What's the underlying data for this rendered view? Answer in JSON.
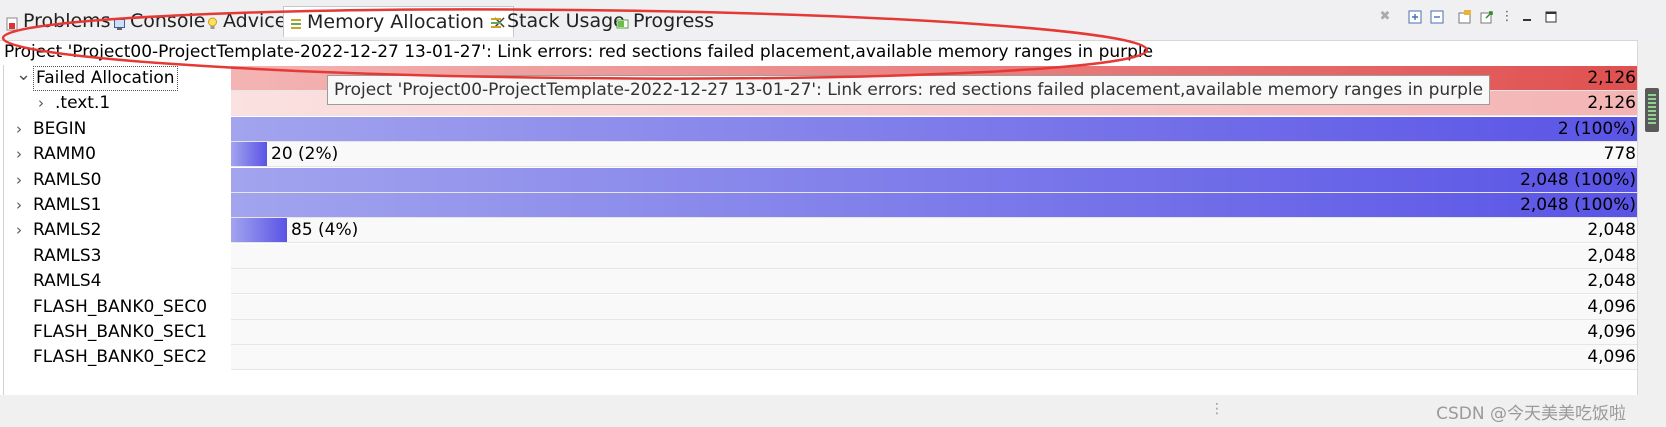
{
  "tabs": [
    {
      "label": "Problems",
      "icon": "problems-icon",
      "active": false
    },
    {
      "label": "Console",
      "icon": "console-icon",
      "active": false
    },
    {
      "label": "Advice",
      "icon": "advice-icon",
      "active": false
    },
    {
      "label": "Memory Allocation",
      "icon": "memory-allocation-icon",
      "active": true
    },
    {
      "label": "Stack Usage",
      "icon": "stack-usage-icon",
      "active": false
    },
    {
      "label": "Progress",
      "icon": "progress-icon",
      "active": false
    }
  ],
  "message": "Project 'Project00-ProjectTemplate-2022-12-27 13-01-27': Link errors: red sections failed placement,available memory ranges in purple",
  "tooltip": "Project 'Project00-ProjectTemplate-2022-12-27 13-01-27': Link errors: red sections failed placement,available memory ranges in purple",
  "colors": {
    "failed": "#e05050",
    "failed_light": "#f4b4b4",
    "purple_light": "#a2a4ee",
    "purple_dark": "#5a54e6",
    "annotation": "#e53935"
  },
  "rows": [
    {
      "name": "Failed Allocation",
      "expanded": true,
      "expander": true,
      "selected": true,
      "kind": "failed",
      "fraction": 1,
      "in_label": "",
      "right_label": "2,126"
    },
    {
      "name": ".text.1",
      "expanded": false,
      "expander": true,
      "child": true,
      "kind": "failed-light",
      "fraction": 1,
      "in_label": "",
      "right_label": "2,126"
    },
    {
      "name": "BEGIN",
      "expanded": false,
      "expander": true,
      "kind": "memory",
      "fraction": 1,
      "in_label": "",
      "right_label": "2 (100%)"
    },
    {
      "name": "RAMM0",
      "expanded": false,
      "expander": true,
      "kind": "memory",
      "fraction": 0.025,
      "in_label": "20 (2%)",
      "right_label": "778"
    },
    {
      "name": "RAMLS0",
      "expanded": false,
      "expander": true,
      "kind": "memory",
      "fraction": 1,
      "in_label": "",
      "right_label": "2,048 (100%)"
    },
    {
      "name": "RAMLS1",
      "expanded": false,
      "expander": true,
      "kind": "memory",
      "fraction": 1,
      "in_label": "",
      "right_label": "2,048 (100%)"
    },
    {
      "name": "RAMLS2",
      "expanded": false,
      "expander": true,
      "kind": "memory",
      "fraction": 0.04,
      "in_label": "85 (4%)",
      "right_label": "2,048"
    },
    {
      "name": "RAMLS3",
      "expanded": false,
      "expander": false,
      "kind": "memory",
      "fraction": 0,
      "in_label": "",
      "right_label": "2,048"
    },
    {
      "name": "RAMLS4",
      "expanded": false,
      "expander": false,
      "kind": "memory",
      "fraction": 0,
      "in_label": "",
      "right_label": "2,048"
    },
    {
      "name": "FLASH_BANK0_SEC0",
      "expanded": false,
      "expander": false,
      "kind": "memory",
      "fraction": 0,
      "in_label": "",
      "right_label": "4,096"
    },
    {
      "name": "FLASH_BANK0_SEC1",
      "expanded": false,
      "expander": false,
      "kind": "memory",
      "fraction": 0,
      "in_label": "",
      "right_label": "4,096"
    },
    {
      "name": "FLASH_BANK0_SEC2",
      "expanded": false,
      "expander": false,
      "kind": "memory",
      "fraction": 0,
      "in_label": "",
      "right_label": "4,096"
    }
  ],
  "watermark": "CSDN @今天美美吃饭啦"
}
